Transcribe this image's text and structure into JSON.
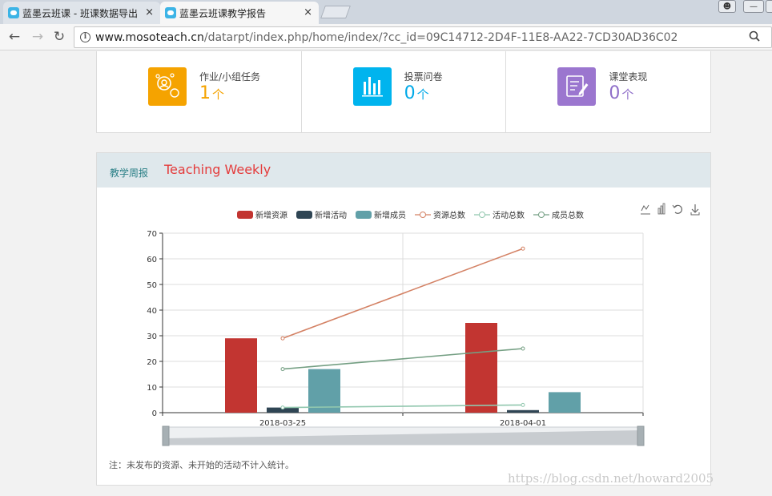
{
  "browser": {
    "tabs": [
      {
        "title": "蓝墨云班课 - 班课数据导出",
        "active": false
      },
      {
        "title": "蓝墨云班课教学报告",
        "active": true
      }
    ],
    "close_glyph": "×",
    "url_host": "www.mosoteach.cn",
    "url_path": "/datarpt/index.php/home/index/?cc_id=09C14712-2D4F-11E8-AA22-7CD30AD36C02"
  },
  "stats": [
    {
      "label": "作业/小组任务",
      "value": "1",
      "unit": "个",
      "color": "#f5a300",
      "icon": "team-task-icon"
    },
    {
      "label": "投票问卷",
      "value": "0",
      "unit": "个",
      "color": "#00a9e8",
      "icon": "vote-bars-icon"
    },
    {
      "label": "课堂表现",
      "value": "0",
      "unit": "个",
      "color": "#8f6fc9",
      "icon": "classroom-performance-icon"
    }
  ],
  "weekly": {
    "title_cn": "教学周报",
    "title_en": "Teaching Weekly",
    "note": "注：未发布的资源、未开始的活动不计入统计。"
  },
  "toolbox": [
    "line-chart-icon",
    "bar-chart-icon",
    "restore-icon",
    "download-icon"
  ],
  "chart_data": {
    "type": "bar",
    "categories": [
      "2018-03-25",
      "2018-04-01"
    ],
    "ylim": [
      0,
      70
    ],
    "yticks": [
      0,
      10,
      20,
      30,
      40,
      50,
      60,
      70
    ],
    "grid": true,
    "legend_position": "top-center",
    "bar_series": [
      {
        "name": "新增资源",
        "values": [
          29,
          35
        ],
        "color": "#c23531"
      },
      {
        "name": "新增活动",
        "values": [
          2,
          1
        ],
        "color": "#2f4554"
      },
      {
        "name": "新增成员",
        "values": [
          17,
          8
        ],
        "color": "#61a0a8"
      }
    ],
    "line_series": [
      {
        "name": "资源总数",
        "values": [
          29,
          64
        ],
        "color": "#d48265"
      },
      {
        "name": "活动总数",
        "values": [
          2,
          3
        ],
        "color": "#91c7ae"
      },
      {
        "name": "成员总数",
        "values": [
          17,
          25
        ],
        "color": "#749f83"
      }
    ]
  },
  "watermark": "https://blog.csdn.net/howard2005"
}
